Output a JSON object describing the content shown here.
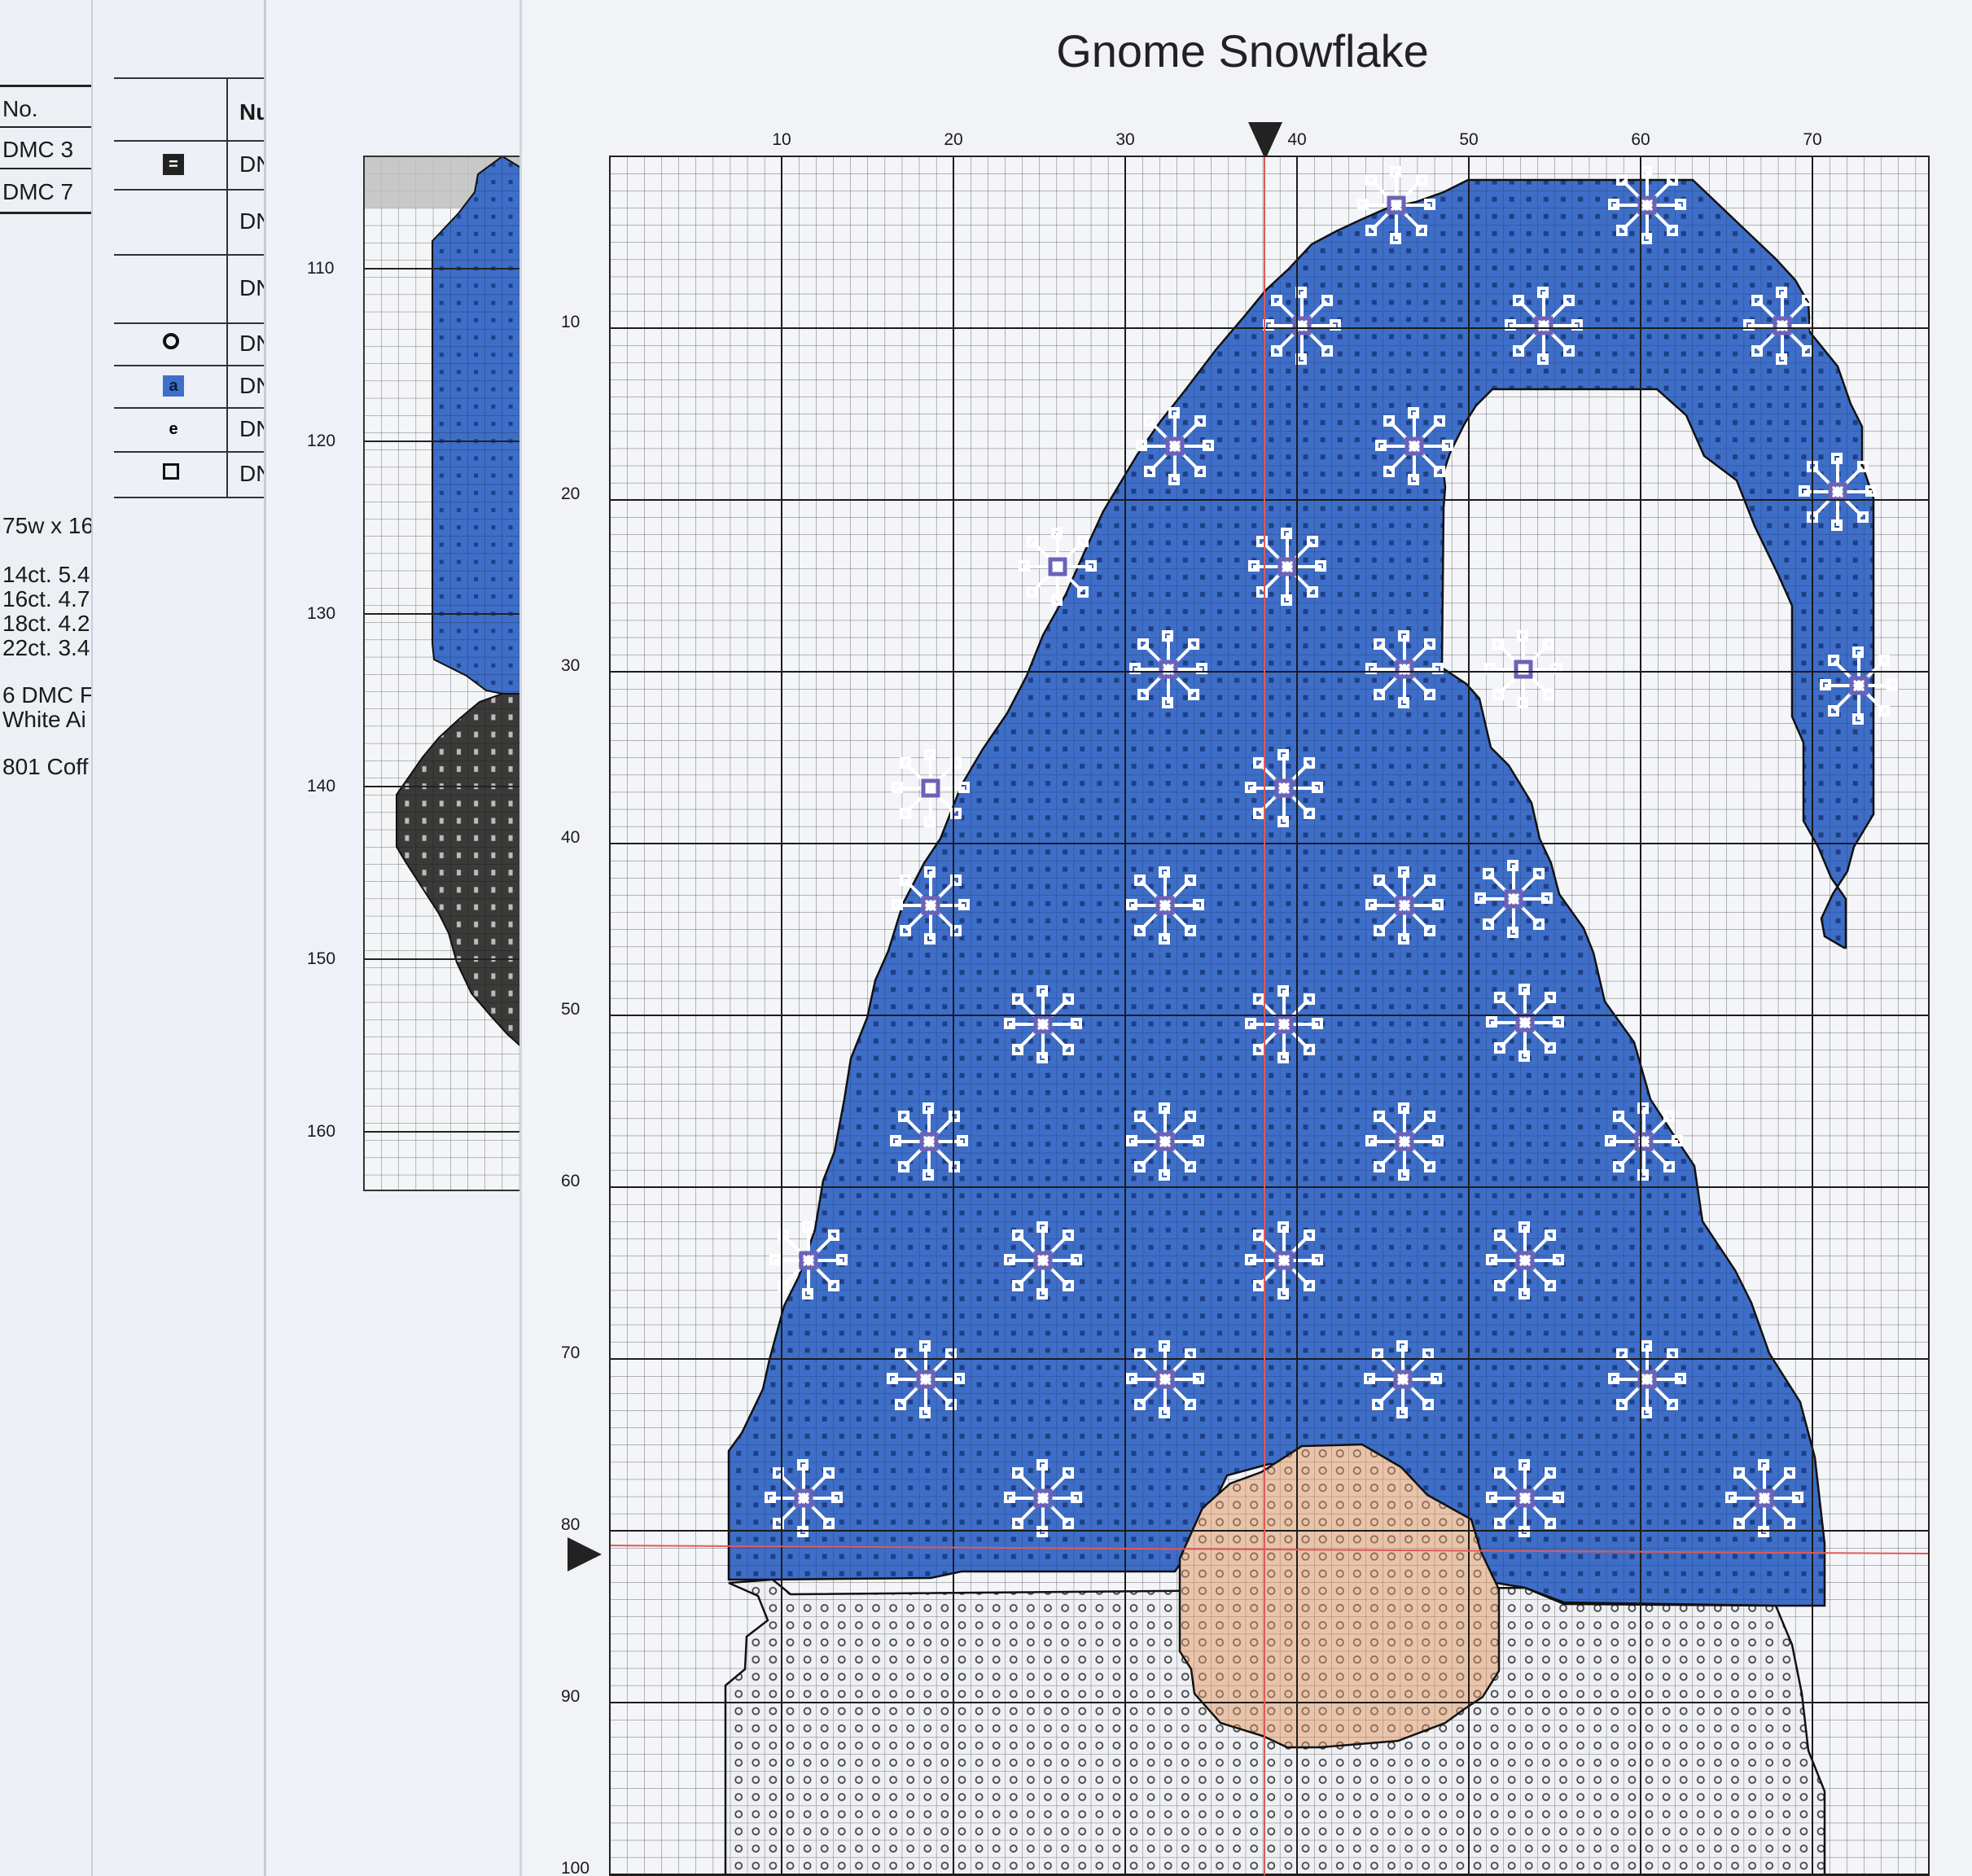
{
  "chart_title": "Gnome Snowflake",
  "sheet1": {
    "header": "No.",
    "rows": [
      "DMC 3",
      "DMC 7"
    ],
    "size_text": "75w x 16",
    "fabric_sizes": [
      "14ct. 5.4",
      "16ct. 4.7",
      "18ct. 4.2",
      "22ct. 3.4"
    ],
    "thread_lines": [
      "6 DMC F",
      "White Ai"
    ],
    "extra_line": "801 Coff"
  },
  "sheet2": {
    "header": "Nu",
    "rows": [
      "DN",
      "DN",
      "DN",
      "DN",
      "DN",
      "DN",
      "DN"
    ],
    "symbols": [
      {
        "glyph": "=",
        "name": "equals-symbol",
        "bg": "#222222",
        "fg": "#ffffff"
      },
      {
        "glyph": "",
        "name": "blank-symbol-1",
        "bg": "none",
        "fg": "#000000"
      },
      {
        "glyph": "",
        "name": "blank-symbol-2",
        "bg": "none",
        "fg": "#000000"
      },
      {
        "glyph": "o",
        "name": "circle-symbol",
        "bg": "none",
        "fg": "#000000"
      },
      {
        "glyph": "a",
        "name": "a-symbol",
        "bg": "#3f6fc8",
        "fg": "#0c1a3a"
      },
      {
        "glyph": "e",
        "name": "e-symbol",
        "bg": "none",
        "fg": "#000000"
      },
      {
        "glyph": "",
        "name": "square-symbol",
        "bg": "none",
        "fg": "#000000"
      }
    ]
  },
  "sheet3": {
    "row_ticks": [
      "110",
      "120",
      "130",
      "140",
      "150",
      "160"
    ]
  },
  "main_chart": {
    "col_ticks": [
      "10",
      "20",
      "30",
      "40",
      "50",
      "60",
      "70"
    ],
    "row_ticks": [
      "10",
      "20",
      "30",
      "40",
      "50",
      "60",
      "70",
      "80",
      "90",
      "100"
    ]
  },
  "colors": {
    "hat_blue": "#3e6ec7",
    "snowflake": "#ffffff",
    "nose": "#e9c4aa",
    "beard": "#f0f1f4",
    "boot_dark": "#3a3a38",
    "grid_line": "#555555",
    "center_line": "#e05555"
  }
}
